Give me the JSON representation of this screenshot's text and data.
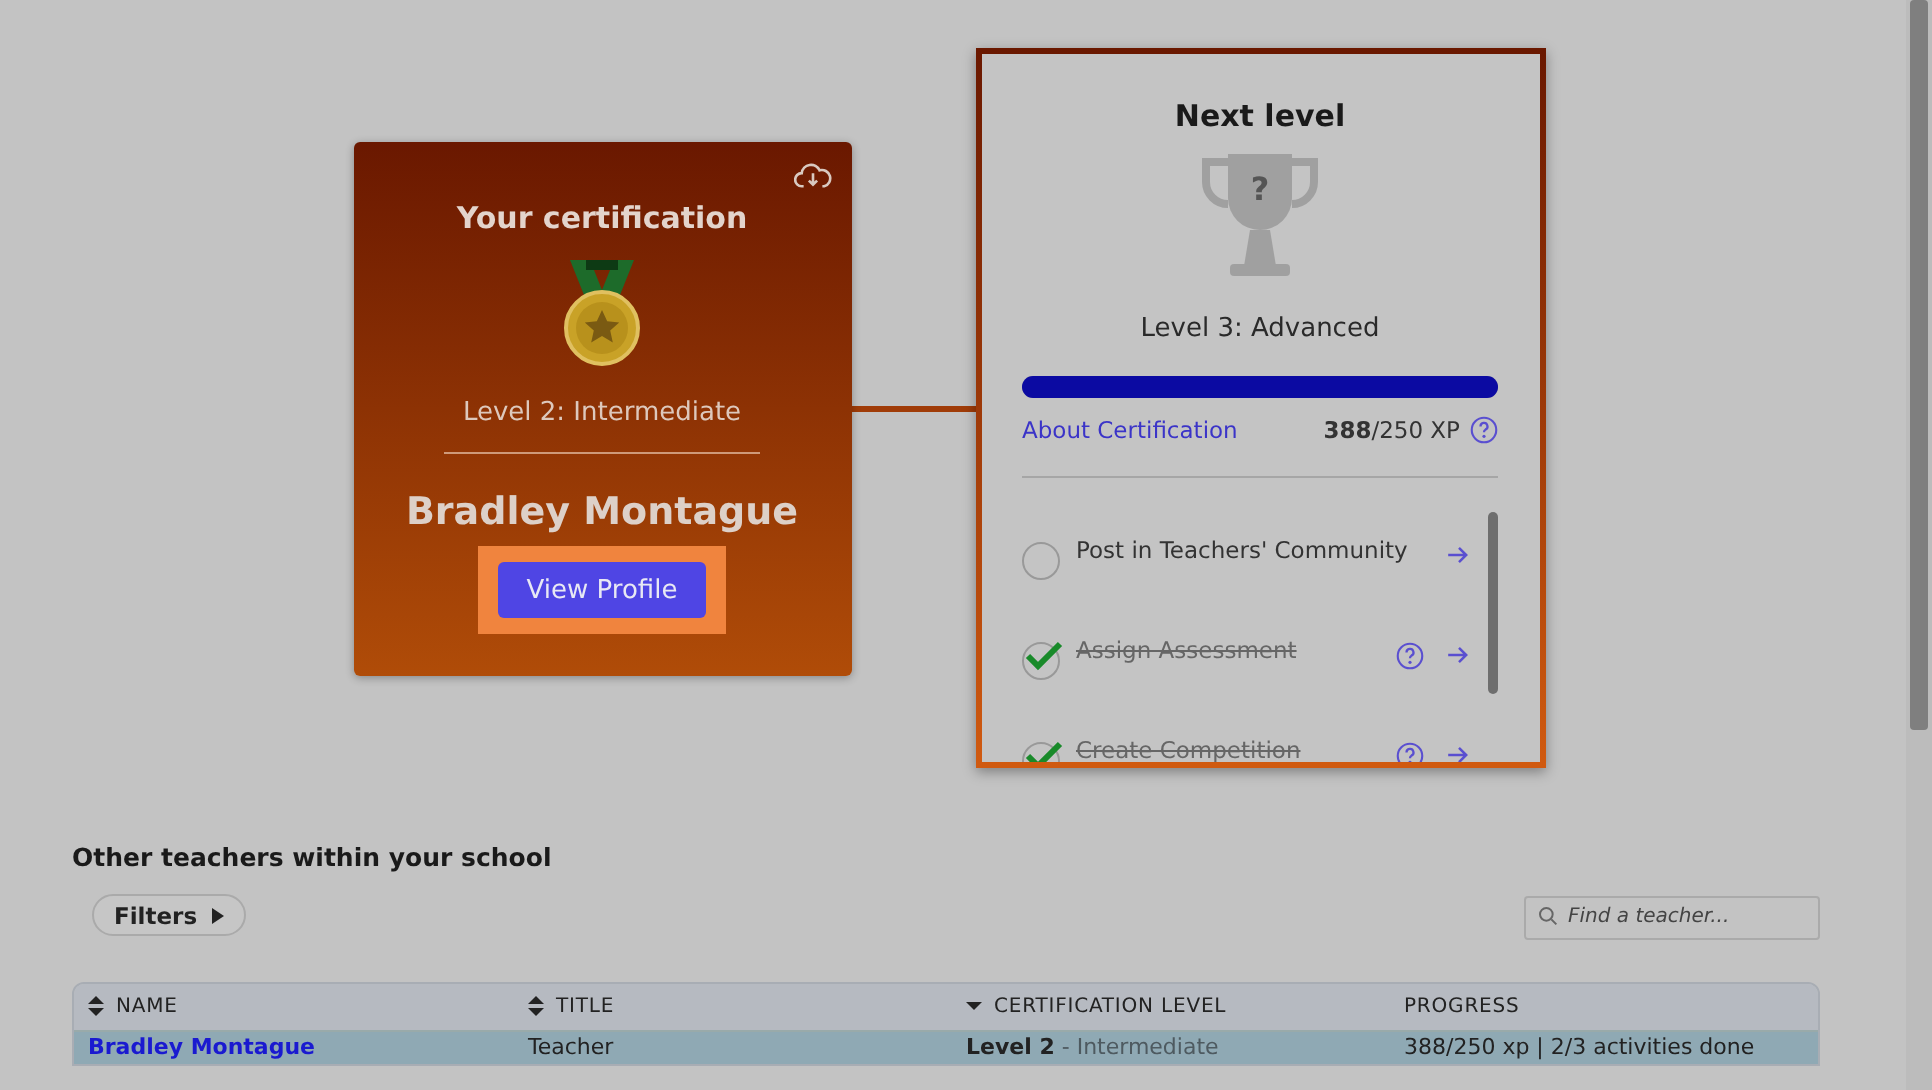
{
  "certification": {
    "title": "Your certification",
    "level": "Level 2: Intermediate",
    "name": "Bradley Montague",
    "button": "View Profile"
  },
  "next_level": {
    "title": "Next level",
    "trophy_mark": "?",
    "level": "Level 3: Advanced",
    "progress": {
      "level": 1
    },
    "link": "About Certification",
    "xp_current": "388",
    "xp_rest": "/250 XP",
    "activities": [
      {
        "label": "Post in Teachers' Community",
        "checked": false,
        "help": false
      },
      {
        "label": "Assign Assessment",
        "checked": true,
        "help": true
      },
      {
        "label": "Create Competition",
        "checked": true,
        "help": true
      }
    ]
  },
  "teachers": {
    "heading": "Other teachers within your school",
    "filters": "Filters",
    "search": {
      "placeholder": "Find a teacher..."
    },
    "columns": [
      {
        "label": "NAME",
        "kind": "sortable"
      },
      {
        "label": "TITLE",
        "kind": "sortable"
      },
      {
        "label": "CERTIFICATION LEVEL",
        "kind": "sorted"
      },
      {
        "label": "PROGRESS",
        "kind": "plain"
      }
    ],
    "rows": [
      {
        "name": "Bradley Montague",
        "title": "Teacher",
        "level": "Level 2",
        "level_name": "- Intermediate",
        "progress": "388/250 xp | 2/3 activities done",
        "selected": true
      }
    ]
  }
}
